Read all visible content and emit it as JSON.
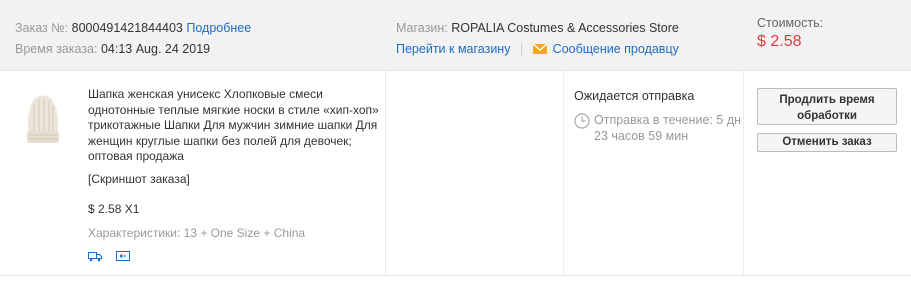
{
  "header": {
    "order_label": "Заказ №:",
    "order_number": "8000491421844403",
    "details_link": "Подробнее",
    "order_time_label": "Время заказа:",
    "order_time": "04:13 Aug. 24 2019",
    "store_label": "Магазин:",
    "store_name": "ROPALIA Costumes & Accessories Store",
    "store_link": "Перейти к магазину",
    "separator": "|",
    "message_link": "Сообщение продавцу",
    "cost_label": "Стоимость:",
    "cost_value": "$ 2.58"
  },
  "item": {
    "title": "Шапка женская унисекс Хлопковые смеси однотонные теплые мягкие носки в стиле «хип-хоп» трикотажные Шапки Для мужчин зимние шапки Для женщин круглые шапки без полей для девочек; оптовая продажа",
    "screenshot_link": "[Скриншот заказа]",
    "price_qty": "$ 2.58 X1",
    "properties": "Характеристики: 13 + One Size + China"
  },
  "status": {
    "state": "Ожидается отправка",
    "wait_text": "Отправка в течение: 5 дн 23 часов 59 мин"
  },
  "actions": {
    "extend_label": "Продлить время обработки",
    "cancel_label": "Отменить заказ"
  },
  "colors": {
    "link": "#1a6cc4",
    "price": "#e4393c",
    "header_bg": "#f2f2f2"
  }
}
